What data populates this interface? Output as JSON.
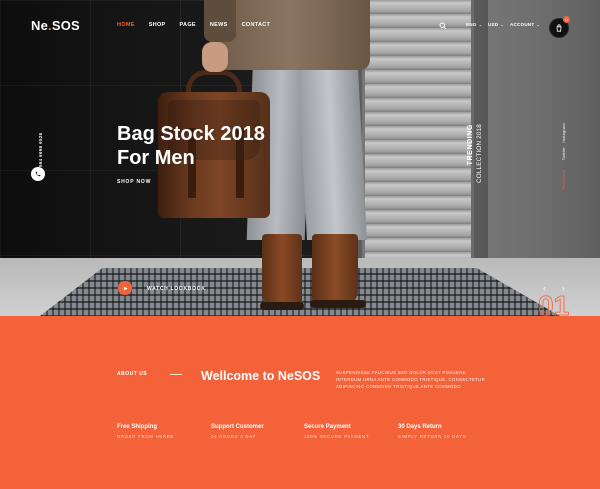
{
  "header": {
    "logo_main": "Ne",
    "logo_dot": ".",
    "logo_rest": "SOS",
    "nav": [
      "HOME",
      "SHOP",
      "PAGE",
      "NEWS",
      "CONTACT"
    ],
    "active_nav": "HOME",
    "language": "ENG",
    "currency": "USD",
    "account": "ACCOUNT",
    "cart_count": "0"
  },
  "hero": {
    "title_line1": "Bag Stock 2018",
    "title_line2": "For Men",
    "cta": "SHOP NOW",
    "phone": "564 6666 6526",
    "trend_title": "TRENDING",
    "trend_subtitle": "COLLECTION 2018",
    "social": [
      "Facebook",
      "Twitter",
      "Instagram"
    ],
    "watch_label": "WATCH LOOKBOOK",
    "slide_number": "01"
  },
  "welcome": {
    "section_label": "ABOUT US",
    "title": "Wellcome to NeSOS",
    "text": "SUSPENDISSE FAUCIBUS SED DOLOR EGET POSUERE INTERDUM URNA ANTE COMMODO TRISTIQUE, CONSECTETUR ADIPISCING COMMODO TRISTIQUE ANTE COMMODO",
    "features": [
      {
        "title": "Free Shipping",
        "subtitle": "ORDER FROM HEREE"
      },
      {
        "title": "Support Customer",
        "subtitle": "24 HOURS A DAY"
      },
      {
        "title": "Secure Payment",
        "subtitle": "100% SECURE PAYMENT"
      },
      {
        "title": "30 Days Return",
        "subtitle": "SIMPLY RETURN 30 DAYS"
      }
    ]
  },
  "colors": {
    "accent": "#f4623a",
    "dark": "#141414"
  },
  "icons": [
    "search-icon",
    "cart-icon",
    "phone-icon",
    "play-icon",
    "arrow-left-icon",
    "arrow-right-icon"
  ]
}
